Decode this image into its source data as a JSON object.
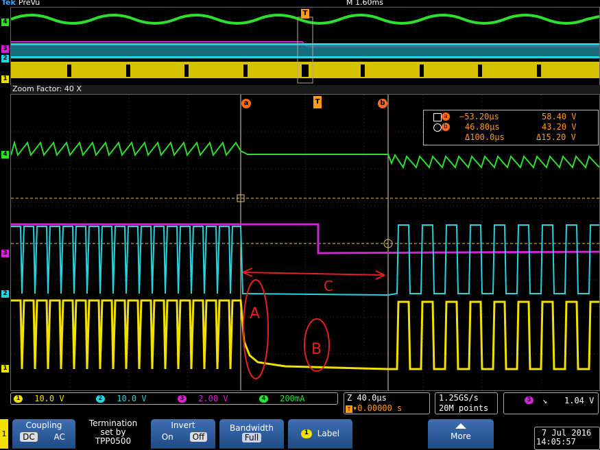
{
  "header": {
    "brand": "Tek",
    "mode": "PreVu",
    "timebase": "M 1.60ms"
  },
  "zoom": {
    "label": "Zoom Factor: 40 X"
  },
  "markers": {
    "trigger": "T",
    "cursor_a": "a",
    "cursor_b": "b"
  },
  "channels": [
    {
      "num": "1",
      "color": "#f2e000"
    },
    {
      "num": "2",
      "color": "#24d4e0"
    },
    {
      "num": "3",
      "color": "#d423d4"
    },
    {
      "num": "4",
      "color": "#2ee02e"
    }
  ],
  "cursor_readout": {
    "a": {
      "time": "−53.20µs",
      "value": "58.40 V"
    },
    "b": {
      "time": "46.80µs",
      "value": "43.20 V"
    },
    "delta": {
      "time": "Δ100.0µs",
      "value": "Δ15.20 V"
    }
  },
  "annotations": {
    "A": "A",
    "B": "B",
    "C": "C"
  },
  "channel_bar": [
    {
      "num": "1",
      "value": "10.0 V",
      "color": "#f2e000"
    },
    {
      "num": "2",
      "value": "10.0 V",
      "color": "#24d4e0"
    },
    {
      "num": "3",
      "value": "2.00 V",
      "color": "#d423d4"
    },
    {
      "num": "4",
      "value": "200mA",
      "color": "#2ee02e"
    }
  ],
  "zoom_info": {
    "scale": "Z 40.0µs",
    "position": "▾0.00000 s"
  },
  "acq_info": {
    "rate": "1.25GS/s",
    "points": "20M points"
  },
  "trigger_info": {
    "channel": "3",
    "slope": "↘",
    "level": "1.04 V"
  },
  "softkeys": {
    "coupling": {
      "title": "Coupling",
      "dc": "DC",
      "ac": "AC"
    },
    "termination": {
      "line1": "Termination",
      "line2": "set by",
      "line3": "TPP0500"
    },
    "invert": {
      "title": "Invert",
      "on": "On",
      "off": "Off"
    },
    "bandwidth": {
      "title": "Bandwidth",
      "value": "Full"
    },
    "label": {
      "badge": "1",
      "title": "Label"
    },
    "more": {
      "title": "More"
    }
  },
  "left_tab": "1",
  "datetime": {
    "date": "7 Jul  2016",
    "time": "14:05:57"
  }
}
